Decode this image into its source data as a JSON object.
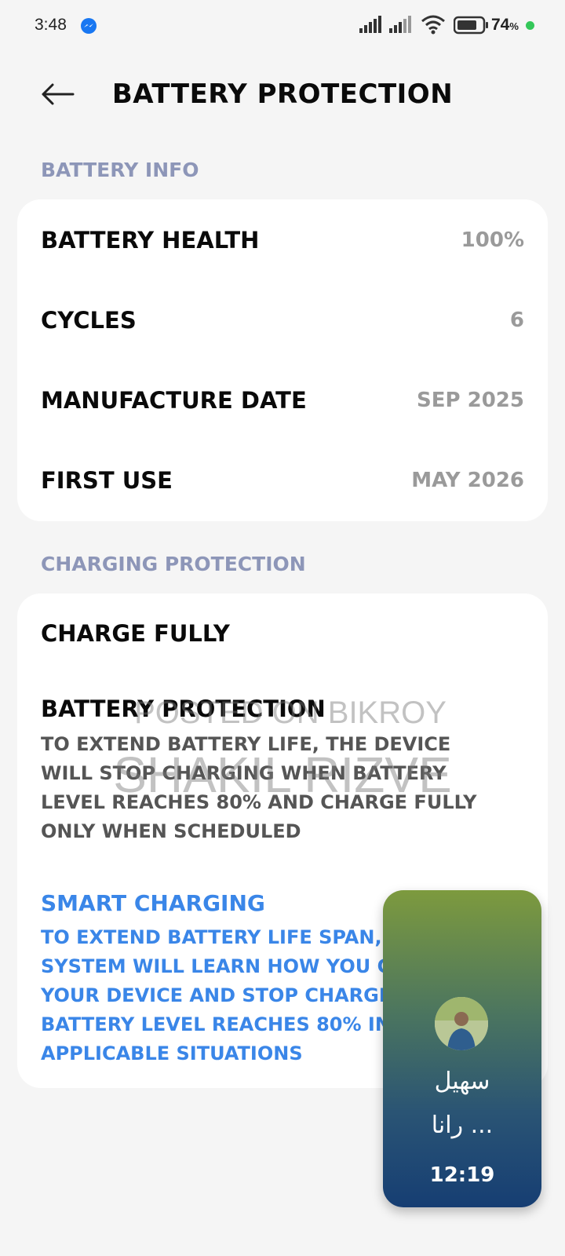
{
  "status_bar": {
    "time": "3:48",
    "battery_percent": "74",
    "battery_unit": "%"
  },
  "header": {
    "title": "BATTERY PROTECTION"
  },
  "battery_info": {
    "section_title": "BATTERY INFO",
    "rows": [
      {
        "label": "BATTERY HEALTH",
        "value": "100%"
      },
      {
        "label": "CYCLES",
        "value": "6"
      },
      {
        "label": "MANUFACTURE DATE",
        "value": "SEP 2025"
      },
      {
        "label": "FIRST USE",
        "value": "MAY 2026"
      }
    ]
  },
  "charging_protection": {
    "section_title": "CHARGING PROTECTION",
    "charge_fully": "CHARGE FULLY",
    "battery_protection_title": "BATTERY PROTECTION",
    "battery_protection_desc": "TO EXTEND BATTERY LIFE, THE DEVICE WILL STOP CHARGING WHEN BATTERY LEVEL REACHES 80% AND CHARGE FULLY ONLY WHEN SCHEDULED",
    "smart_charging_title": "SMART CHARGING",
    "smart_charging_desc": "TO EXTEND BATTERY LIFE SPAN, THE SYSTEM WILL LEARN HOW YOU CHARGE YOUR DEVICE AND STOP CHARGING WHEN BATTERY LEVEL REACHES 80% IN APPLICABLE SITUATIONS"
  },
  "watermark": {
    "line1": "POSTED ON BIKROY",
    "line2": "SHAKIL RIZVE"
  },
  "call_bubble": {
    "name_line1": "سهيل",
    "name_line2": "رانا ...",
    "timer": "12:19"
  },
  "colors": {
    "background": "#f5f5f5",
    "section_header": "#8d96b8",
    "accent_blue": "#3a86e8",
    "value_gray": "#9a9a9a"
  },
  "icons": [
    "messenger-icon",
    "signal-icon",
    "wifi-icon",
    "battery-icon",
    "back-arrow-icon"
  ]
}
